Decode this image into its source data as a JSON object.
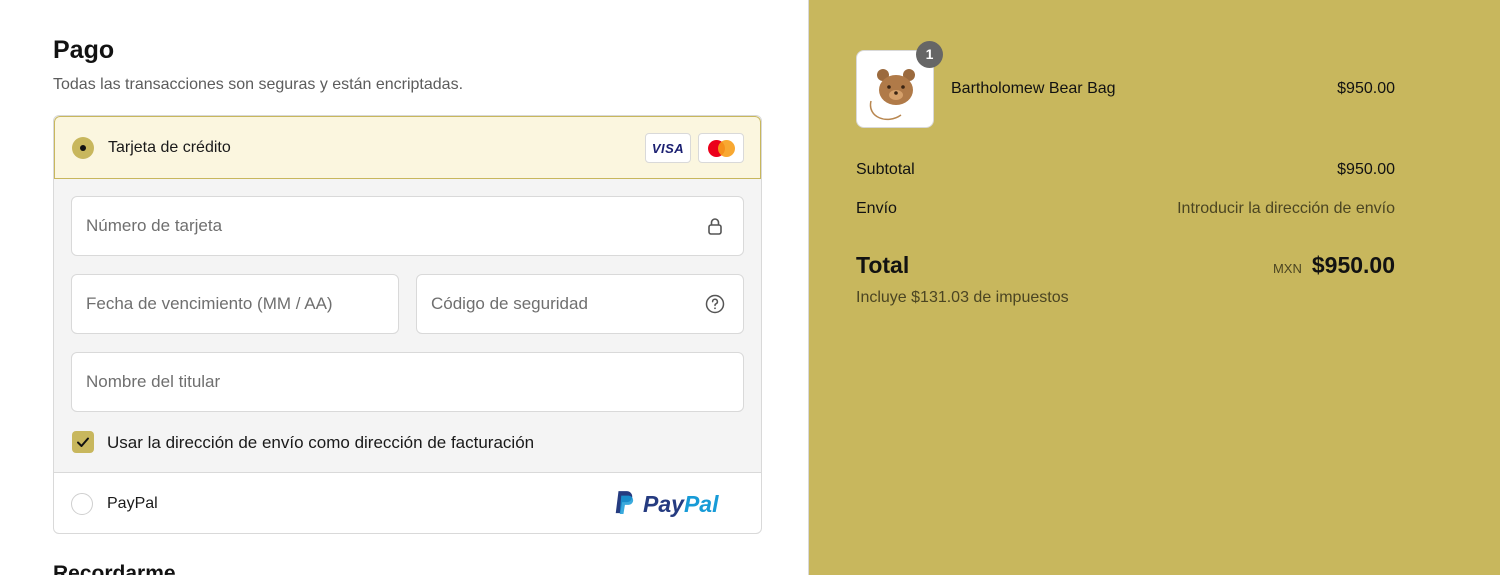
{
  "payment": {
    "title": "Pago",
    "subtitle": "Todas las transacciones son seguras y están encriptadas.",
    "options": [
      {
        "label": "Tarjeta de crédito",
        "selected": true,
        "badges": [
          "VISA",
          "mastercard-icon"
        ]
      },
      {
        "label": "PayPal",
        "selected": false,
        "logo_text": [
          "Pay",
          "Pal"
        ]
      }
    ],
    "card_fields": {
      "card_number_placeholder": "Número de tarjeta",
      "expiry_placeholder": "Fecha de vencimiento (MM / AA)",
      "cvc_placeholder": "Código de seguridad",
      "name_placeholder": "Nombre del titular"
    },
    "billing_checkbox": {
      "label": "Usar la dirección de envío como dirección de facturación",
      "checked": true
    },
    "next_section_title": "Recordarme"
  },
  "summary": {
    "product": {
      "name": "Bartholomew Bear Bag",
      "price": "$950.00",
      "quantity": "1"
    },
    "subtotal_label": "Subtotal",
    "subtotal_value": "$950.00",
    "shipping_label": "Envío",
    "shipping_value": "Introducir la dirección de envío",
    "total_label": "Total",
    "currency": "MXN",
    "total_value": "$950.00",
    "tax_note": "Incluye $131.03 de impuestos"
  },
  "colors": {
    "accent": "#c8b75d",
    "selected_bg": "#fbf6df",
    "muted_text": "#5c5c5c"
  }
}
